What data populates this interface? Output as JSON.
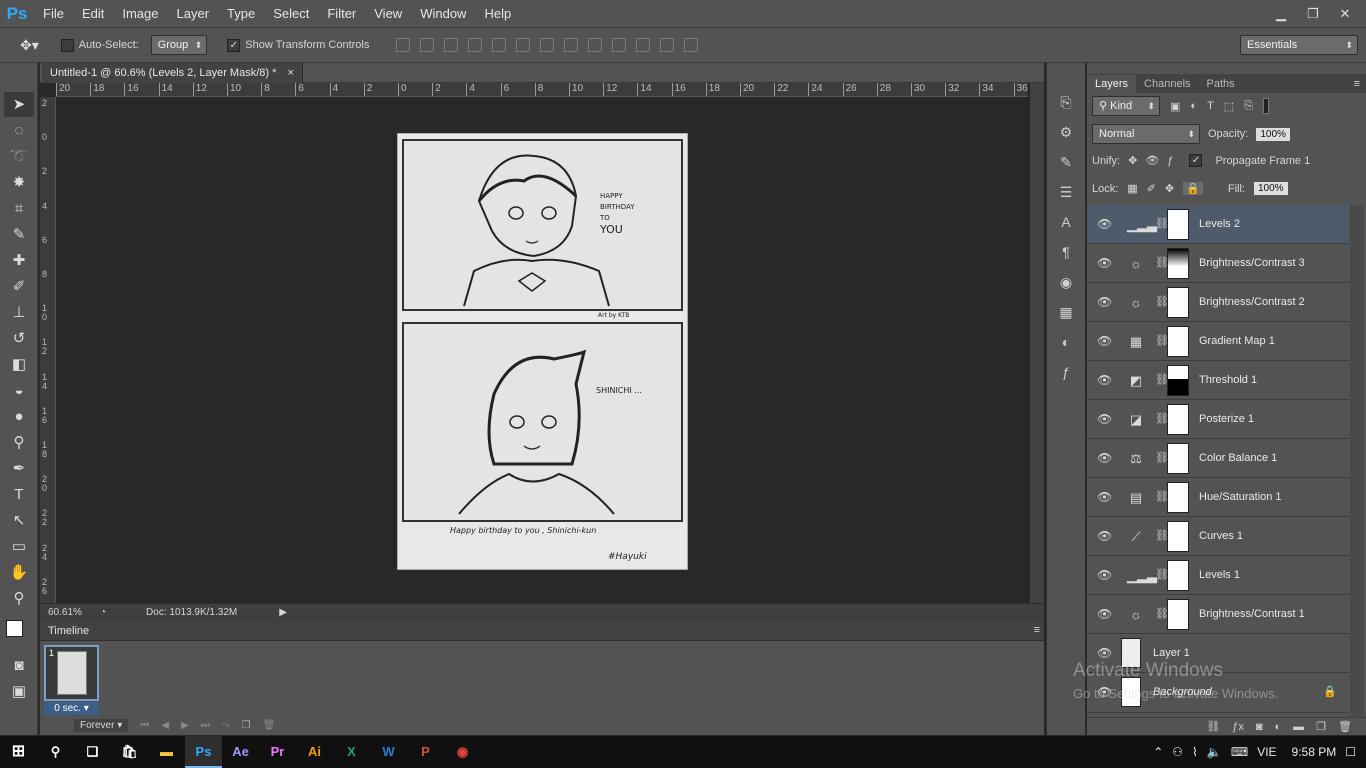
{
  "app": {
    "logo": "Ps"
  },
  "menu": [
    "File",
    "Edit",
    "Image",
    "Layer",
    "Type",
    "Select",
    "Filter",
    "View",
    "Window",
    "Help"
  ],
  "options_bar": {
    "auto_select_label": "Auto-Select:",
    "auto_select_value": "Group",
    "show_transform_label": "Show Transform Controls",
    "workspace": "Essentials"
  },
  "document": {
    "tab_title": "Untitled-1 @ 60.6% (Levels 2, Layer Mask/8) *",
    "close_glyph": "×",
    "ruler_top": [
      "20",
      "18",
      "16",
      "14",
      "12",
      "10",
      "8",
      "6",
      "4",
      "2",
      "0",
      "2",
      "4",
      "6",
      "8",
      "10",
      "12",
      "14",
      "16",
      "18",
      "20",
      "22",
      "24",
      "26",
      "28",
      "30",
      "32",
      "34",
      "36"
    ],
    "ruler_left": [
      "2",
      "0",
      "2",
      "4",
      "6",
      "8",
      "10",
      "12",
      "14",
      "16",
      "18",
      "20",
      "22",
      "24",
      "26"
    ],
    "artwork": {
      "panel1_text": [
        "HAPPY",
        "BIRTHDAY",
        "TO",
        "YOU"
      ],
      "panel1_credit": "Art by KTB",
      "panel2_text": "SHINICHI ...",
      "caption": "Happy birthday to you , Shinichi-kun",
      "signature": "#Hayuki"
    }
  },
  "status": {
    "zoom": "60.61%",
    "doc_info": "Doc: 1013.9K/1.32M"
  },
  "timeline": {
    "title": "Timeline",
    "frame_number": "1",
    "frame_delay": "0 sec.",
    "loop": "Forever"
  },
  "layers_panel": {
    "tabs": [
      "Layers",
      "Channels",
      "Paths"
    ],
    "filter": "Kind",
    "blend_mode": "Normal",
    "opacity_label": "Opacity:",
    "opacity_value": "100%",
    "unify_label": "Unify:",
    "propagate_label": "Propagate Frame 1",
    "lock_label": "Lock:",
    "fill_label": "Fill:",
    "fill_value": "100%",
    "layers": [
      {
        "name": "Levels 2",
        "icon": "levels-icon",
        "glyph": "▁▂▃",
        "selected": true
      },
      {
        "name": "Brightness/Contrast 3",
        "icon": "brightness-icon",
        "glyph": "☼"
      },
      {
        "name": "Brightness/Contrast 2",
        "icon": "brightness-icon",
        "glyph": "☼"
      },
      {
        "name": "Gradient Map 1",
        "icon": "gradient-map-icon",
        "glyph": "▦"
      },
      {
        "name": "Threshold 1",
        "icon": "threshold-icon",
        "glyph": "◩"
      },
      {
        "name": "Posterize 1",
        "icon": "posterize-icon",
        "glyph": "◪"
      },
      {
        "name": "Color Balance 1",
        "icon": "balance-icon",
        "glyph": "⚖"
      },
      {
        "name": "Hue/Saturation 1",
        "icon": "hue-saturation-icon",
        "glyph": "▤"
      },
      {
        "name": "Curves 1",
        "icon": "curves-icon",
        "glyph": "⟋"
      },
      {
        "name": "Levels 1",
        "icon": "levels-icon",
        "glyph": "▁▂▃"
      },
      {
        "name": "Brightness/Contrast 1",
        "icon": "brightness-icon",
        "glyph": "☼"
      }
    ],
    "layer1_name": "Layer 1",
    "background_name": "Background"
  },
  "watermark": {
    "line1": "Activate Windows",
    "line2": "Go to Settings to activate Windows."
  },
  "taskbar": {
    "apps": [
      "Ps",
      "Ae",
      "Pr",
      "Ai",
      "X",
      "W",
      "P"
    ],
    "lang": "VIE",
    "time": "9:58 PM"
  },
  "colors": {
    "accent": "#31a8ff",
    "selected_layer": "#4f5b6b",
    "panel": "#535353"
  }
}
